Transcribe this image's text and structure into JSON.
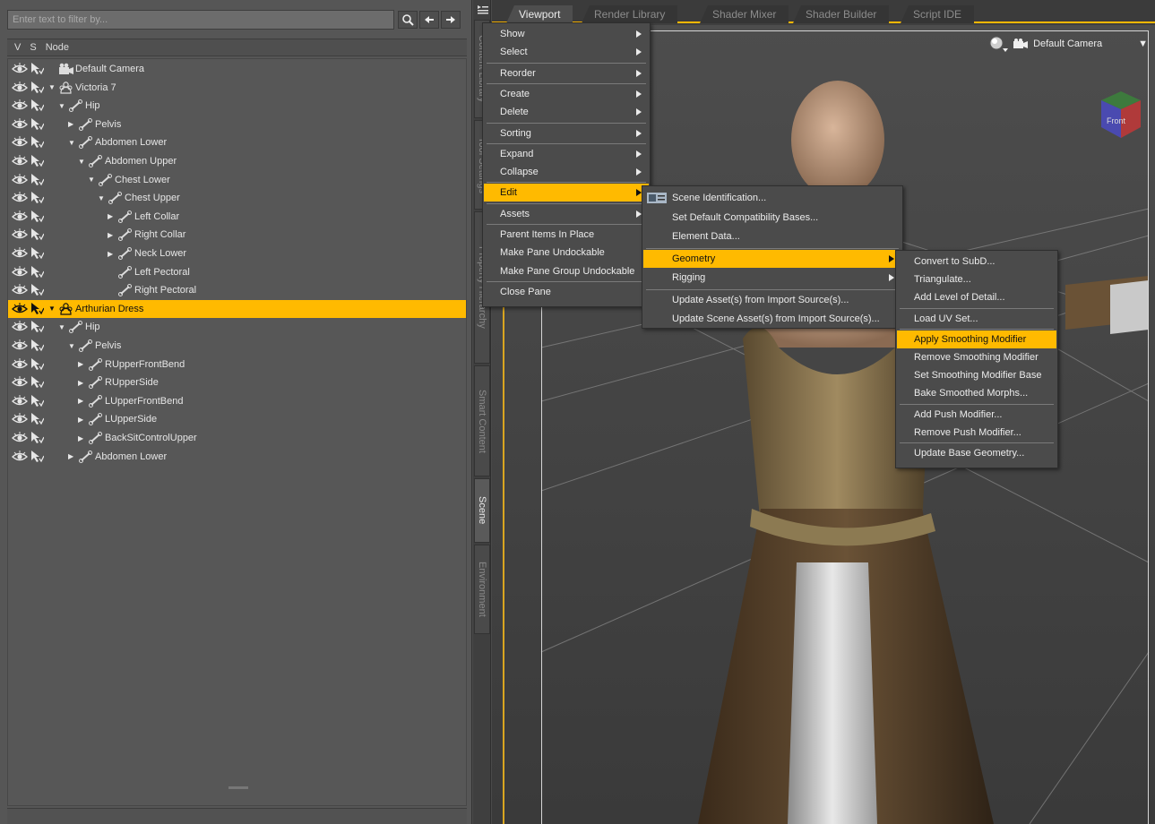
{
  "scene_pane": {
    "filter_placeholder": "Enter text to filter by...",
    "columns": {
      "v": "V",
      "s": "S",
      "node": "Node"
    },
    "nodes": [
      {
        "label": "Default Camera",
        "type": "camera",
        "depth": 0,
        "expander": "none"
      },
      {
        "label": "Victoria 7",
        "type": "figure",
        "depth": 0,
        "expander": "expanded"
      },
      {
        "label": "Hip",
        "type": "bone",
        "depth": 1,
        "expander": "expanded"
      },
      {
        "label": "Pelvis",
        "type": "bone",
        "depth": 2,
        "expander": "collapsed"
      },
      {
        "label": "Abdomen Lower",
        "type": "bone",
        "depth": 2,
        "expander": "expanded"
      },
      {
        "label": "Abdomen Upper",
        "type": "bone",
        "depth": 3,
        "expander": "expanded"
      },
      {
        "label": "Chest Lower",
        "type": "bone",
        "depth": 4,
        "expander": "expanded"
      },
      {
        "label": "Chest Upper",
        "type": "bone",
        "depth": 5,
        "expander": "expanded"
      },
      {
        "label": "Left Collar",
        "type": "bone",
        "depth": 6,
        "expander": "collapsed"
      },
      {
        "label": "Right Collar",
        "type": "bone",
        "depth": 6,
        "expander": "collapsed"
      },
      {
        "label": "Neck Lower",
        "type": "bone",
        "depth": 6,
        "expander": "collapsed"
      },
      {
        "label": "Left Pectoral",
        "type": "bone",
        "depth": 6,
        "expander": "none"
      },
      {
        "label": "Right Pectoral",
        "type": "bone",
        "depth": 6,
        "expander": "none"
      },
      {
        "label": "Arthurian Dress",
        "type": "figure",
        "depth": 0,
        "expander": "expanded",
        "selected": true
      },
      {
        "label": "Hip",
        "type": "bone",
        "depth": 1,
        "expander": "expanded"
      },
      {
        "label": "Pelvis",
        "type": "bone",
        "depth": 2,
        "expander": "expanded"
      },
      {
        "label": "RUpperFrontBend",
        "type": "bone",
        "depth": 3,
        "expander": "collapsed"
      },
      {
        "label": "RUpperSide",
        "type": "bone",
        "depth": 3,
        "expander": "collapsed"
      },
      {
        "label": "LUpperFrontBend",
        "type": "bone",
        "depth": 3,
        "expander": "collapsed"
      },
      {
        "label": "LUpperSide",
        "type": "bone",
        "depth": 3,
        "expander": "collapsed"
      },
      {
        "label": "BackSitControlUpper",
        "type": "bone",
        "depth": 3,
        "expander": "collapsed"
      },
      {
        "label": "Abdomen Lower",
        "type": "bone",
        "depth": 2,
        "expander": "collapsed"
      }
    ]
  },
  "side_tabs": [
    "Content Library",
    "Tool Settings",
    "Property Hierarchy",
    "Smart Content",
    "Scene",
    "Environment"
  ],
  "active_side_tab": "Scene",
  "viewport_tabs": [
    "Viewport",
    "Render Library",
    "Shader Mixer",
    "Shader Builder",
    "Script IDE"
  ],
  "active_viewport_tab": "Viewport",
  "camera_label": "Default Camera",
  "cube_face_label": "Front",
  "menus": {
    "main": [
      {
        "label": "Show",
        "submenu": true
      },
      {
        "label": "Select",
        "submenu": true
      },
      {
        "label": "Reorder",
        "submenu": true
      },
      {
        "label": "Create",
        "submenu": true
      },
      {
        "label": "Delete",
        "submenu": true
      },
      {
        "label": "Sorting",
        "submenu": true
      },
      {
        "label": "Expand",
        "submenu": true
      },
      {
        "label": "Collapse",
        "submenu": true
      },
      {
        "label": "Edit",
        "submenu": true,
        "highlight": true
      },
      {
        "label": "Assets",
        "submenu": true
      },
      {
        "label": "Parent Items In Place",
        "submenu": false
      },
      {
        "label": "Make Pane Undockable",
        "submenu": false
      },
      {
        "label": "Make Pane Group Undockable",
        "submenu": false
      },
      {
        "label": "Close Pane",
        "submenu": false
      }
    ],
    "edit": [
      {
        "label": "Scene Identification...",
        "submenu": false,
        "icon": true
      },
      {
        "label": "Set Default Compatibility Bases...",
        "submenu": false
      },
      {
        "label": "Element Data...",
        "submenu": false
      },
      {
        "label": "Geometry",
        "submenu": true,
        "highlight": true
      },
      {
        "label": "Rigging",
        "submenu": true
      },
      {
        "label": "Update Asset(s) from Import Source(s)...",
        "submenu": false
      },
      {
        "label": "Update Scene Asset(s) from Import Source(s)...",
        "submenu": false
      }
    ],
    "geometry": [
      {
        "label": "Convert to SubD...",
        "submenu": false
      },
      {
        "label": "Triangulate...",
        "submenu": false
      },
      {
        "label": "Add Level of Detail...",
        "submenu": false
      },
      {
        "label": "Load UV Set...",
        "submenu": false
      },
      {
        "label": "Apply Smoothing Modifier",
        "submenu": false,
        "highlight": true
      },
      {
        "label": "Remove Smoothing Modifier",
        "submenu": false
      },
      {
        "label": "Set Smoothing Modifier Base",
        "submenu": false
      },
      {
        "label": "Bake Smoothed Morphs...",
        "submenu": false
      },
      {
        "label": "Add Push Modifier...",
        "submenu": false
      },
      {
        "label": "Remove Push Modifier...",
        "submenu": false
      },
      {
        "label": "Update Base Geometry...",
        "submenu": false
      }
    ]
  },
  "colors": {
    "accent": "#ffba00",
    "pane": "#565656",
    "menu": "#4b4b4b"
  }
}
